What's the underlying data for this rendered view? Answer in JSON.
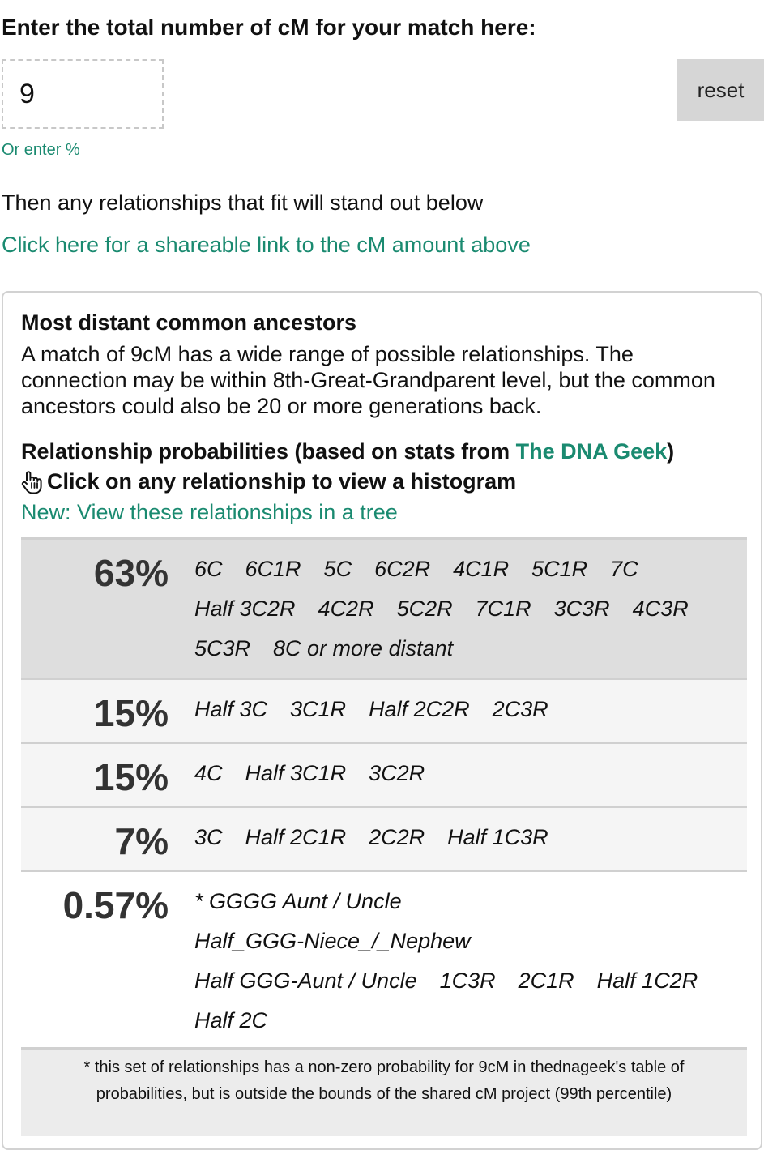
{
  "header": {
    "heading": "Enter the total number of cM for your match here:",
    "cm_value": "9",
    "reset_label": "reset",
    "alt_link": "Or enter %",
    "instructions": "Then any relationships that fit will stand out below",
    "share_link": "Click here for a shareable link to the cM amount above"
  },
  "panel": {
    "mdca_title": "Most distant common ancestors",
    "mdca_text": "A match of 9cM has a wide range of possible relationships. The connection may be within 8th-Great-Grandparent level, but the common ancestors could also be 20 or more generations back.",
    "prob_title_prefix": "Relationship probabilities (based on stats from ",
    "prob_title_source": "The DNA Geek",
    "prob_title_suffix": ")",
    "hint_icon": "pointing-hand-icon",
    "hint_text": "Click on any relationship to view a histogram",
    "tree_link": "New: View these relationships in a tree",
    "groups": [
      {
        "percent": "63%",
        "relationships": [
          "6C",
          "6C1R",
          "5C",
          "6C2R",
          "4C1R",
          "5C1R",
          "7C",
          "Half 3C2R",
          "4C2R",
          "5C2R",
          "7C1R",
          "3C3R",
          "4C3R",
          "5C3R",
          "8C or more distant"
        ]
      },
      {
        "percent": "15%",
        "relationships": [
          "Half 3C",
          "3C1R",
          "Half 2C2R",
          "2C3R"
        ]
      },
      {
        "percent": "15%",
        "relationships": [
          "4C",
          "Half 3C1R",
          "3C2R"
        ]
      },
      {
        "percent": "7%",
        "relationships": [
          "3C",
          "Half 2C1R",
          "2C2R",
          "Half 1C3R"
        ]
      },
      {
        "percent": "0.57%",
        "relationships": [
          "* GGGG Aunt / Uncle",
          "Half_GGG-Niece_/_Nephew",
          "Half GGG-Aunt / Uncle",
          "1C3R",
          "2C1R",
          "Half 1C2R",
          "Half 2C"
        ]
      }
    ],
    "footnote": "* this set of relationships has a non-zero probability for 9cM in thednageek's table of probabilities, but is outside the bounds of the shared cM project (99th percentile)"
  },
  "colors": {
    "link": "#1a8a70",
    "top_row_bg": "#dedede",
    "mid_row_bg": "#f5f5f5"
  }
}
